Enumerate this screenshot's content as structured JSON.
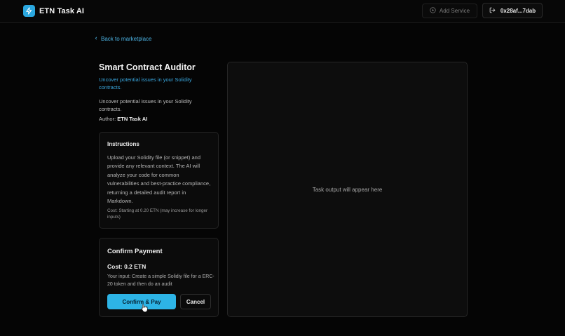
{
  "header": {
    "app_name": "ETN Task AI",
    "add_service_label": "Add Service",
    "wallet_label": "0x28af...7dab"
  },
  "nav": {
    "back_label": "Back to marketplace"
  },
  "service": {
    "title": "Smart Contract Auditor",
    "tagline": "Uncover potential issues in your Solidity contracts.",
    "description": "Uncover potential issues in your Solidity contracts.",
    "author_label": "Author:",
    "author_name": "ETN Task AI"
  },
  "instructions": {
    "heading": "Instructions",
    "body": "Upload your Solidity file (or snippet) and provide any relevant context. The AI will analyze your code for common vulnerabilities and best-practice compliance, returning a detailed audit report in Markdown.",
    "cost_note": "Cost: Starting at 0.20 ETN (may increase for longer inputs)"
  },
  "payment": {
    "heading": "Confirm Payment",
    "cost": "Cost: 0.2 ETN",
    "input_text": "Your input: Create a simple Solidiy file for a ERC-20 token and then do an audit",
    "confirm_label": "Confirm & Pay",
    "cancel_label": "Cancel"
  },
  "output": {
    "placeholder": "Task output will appear here"
  },
  "colors": {
    "accent": "#2db4e6",
    "link": "#4cb2e2",
    "background": "#050505"
  },
  "icons": {
    "logo": "lightning-icon",
    "add": "plus-circle-icon",
    "wallet": "logout-icon",
    "back": "chevron-left-icon",
    "cursor": "hand-pointer-icon"
  }
}
